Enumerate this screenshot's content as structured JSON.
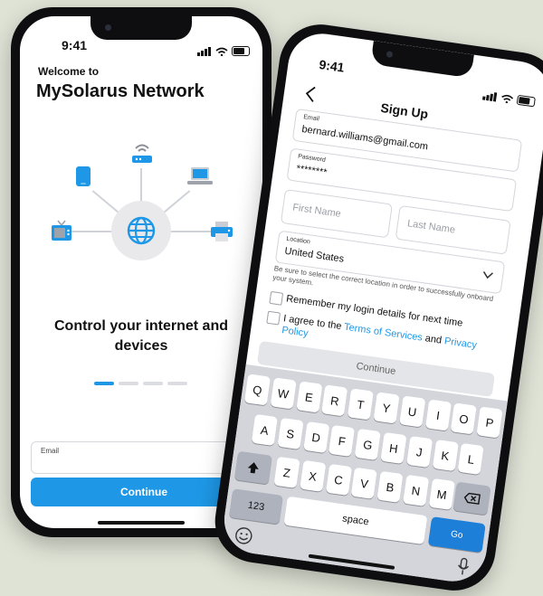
{
  "left_phone": {
    "status_time": "9:41",
    "welcome": "Welcome to",
    "title": "MySolarus Network",
    "headline": "Control your internet and devices",
    "pager": {
      "total": 4,
      "active": 0
    },
    "email_label": "Email",
    "continue_label": "Continue"
  },
  "right_phone": {
    "status_time": "9:41",
    "back_icon": "chevron-left-icon",
    "title": "Sign Up",
    "email": {
      "label": "Email",
      "value": "bernard.williams@gmail.com"
    },
    "password": {
      "label": "Password",
      "value": "********"
    },
    "first_name_placeholder": "First Name",
    "last_name_placeholder": "Last Name",
    "location": {
      "label": "Location",
      "value": "United States"
    },
    "location_helper": "Be sure to select the correct location in order to successfully onboard your system.",
    "remember_label": "Remember my login details for next time",
    "agree_prefix": "I agree to the ",
    "terms_link": "Terms of Services",
    "agree_and": " and ",
    "privacy_link": "Privacy Policy",
    "continue_label": "Continue",
    "keyboard": {
      "row1": [
        "Q",
        "W",
        "E",
        "R",
        "T",
        "Y",
        "U",
        "I",
        "O",
        "P"
      ],
      "row2": [
        "A",
        "S",
        "D",
        "F",
        "G",
        "H",
        "J",
        "K",
        "L"
      ],
      "row3": [
        "Z",
        "X",
        "C",
        "V",
        "B",
        "N",
        "M"
      ],
      "numbers_key": "123",
      "space_key": "space",
      "go_key": "Go"
    }
  },
  "colors": {
    "accent": "#1e98e6",
    "background": "#dfe3d6"
  }
}
